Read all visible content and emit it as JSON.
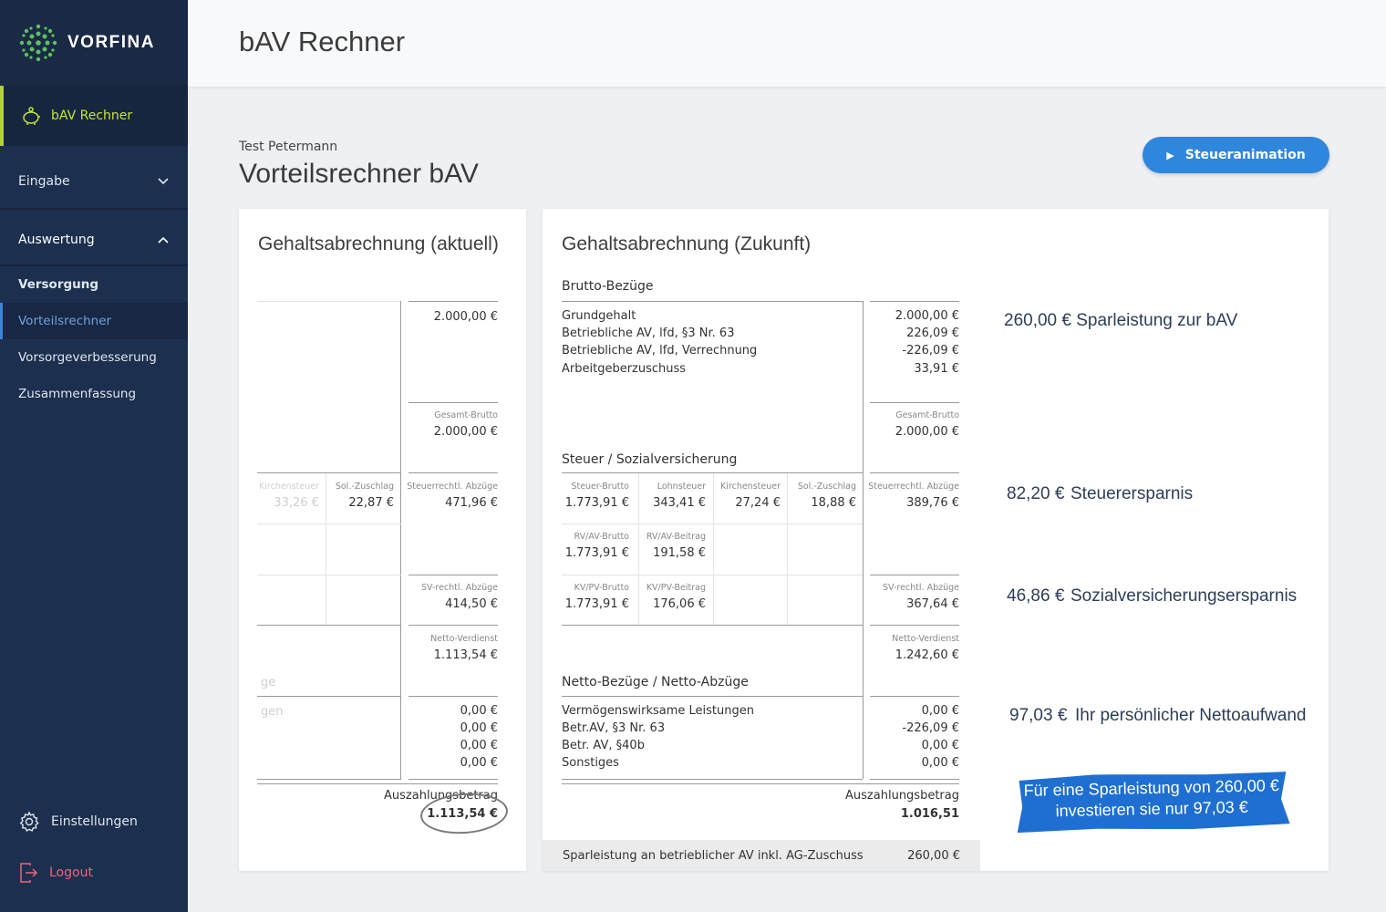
{
  "brand": {
    "name": "VORFINA"
  },
  "sidebar": {
    "active": "bAV Rechner",
    "eingabe": "Eingabe",
    "auswertung": "Auswertung",
    "sub_items": [
      "Versorgung",
      "Vorteilsrechner",
      "Vorsorgeverbesserung",
      "Zusammenfassung"
    ],
    "settings": "Einstellungen",
    "logout": "Logout"
  },
  "header": {
    "title": "bAV Rechner"
  },
  "page": {
    "customer": "Test Petermann",
    "title": "Vorteilsrechner bAV",
    "animation_button": "Steueranimation"
  },
  "current": {
    "title": "Gehaltsabrechnung (aktuell)",
    "brutto_value": "2.000,00 €",
    "gesamt_brutto_label": "Gesamt-Brutto",
    "gesamt_brutto_value": "2.000,00 €",
    "kirchensteuer_label": "Kirchensteuer",
    "kirchensteuer_value": "33,26 €",
    "soli_label": "Sol.-Zuschlag",
    "soli_value": "22,87 €",
    "steuer_abz_label": "Steuerrechtl. Abzüge",
    "steuer_abz_value": "471,96 €",
    "sv_abz_label": "SV-rechtl. Abzüge",
    "sv_abz_value": "414,50 €",
    "netto_label": "Netto-Verdienst",
    "netto_value": "1.113,54 €",
    "faded_ge": "ge",
    "faded_gen": "gen",
    "deductions": [
      "0,00 €",
      "0,00 €",
      "0,00 €",
      "0,00 €"
    ],
    "payout_label": "Auszahlungsbetrag",
    "payout_value": "1.113,54 €"
  },
  "future": {
    "title": "Gehaltsabrechnung (Zukunft)",
    "brutto_heading": "Brutto-Bezüge",
    "brutto_items": [
      "Grundgehalt",
      "Betriebliche AV, lfd, §3 Nr. 63",
      "Betriebliche AV, lfd, Verrechnung",
      "Arbeitgeberzuschuss"
    ],
    "brutto_values": [
      "2.000,00 €",
      "226,09 €",
      "-226,09 €",
      "33,91 €"
    ],
    "gesamt_brutto_label": "Gesamt-Brutto",
    "gesamt_brutto_value": "2.000,00 €",
    "steuer_heading": "Steuer / Sozialversicherung",
    "steuer_cells": [
      {
        "label": "Steuer-Brutto",
        "value": "1.773,91 €"
      },
      {
        "label": "Lohnsteuer",
        "value": "343,41 €"
      },
      {
        "label": "Kirchensteuer",
        "value": "27,24 €"
      },
      {
        "label": "Sol.-Zuschlag",
        "value": "18,88 €"
      }
    ],
    "steuer_abz_label": "Steuerrechtl. Abzüge",
    "steuer_abz_value": "389,76 €",
    "rv_cells": [
      {
        "label": "RV/AV-Brutto",
        "value": "1.773,91 €"
      },
      {
        "label": "RV/AV-Beitrag",
        "value": "191,58 €"
      }
    ],
    "kv_cells": [
      {
        "label": "KV/PV-Brutto",
        "value": "1.773,91 €"
      },
      {
        "label": "KV/PV-Beitrag",
        "value": "176,06 €"
      }
    ],
    "sv_abz_label": "SV-rechtl. Abzüge",
    "sv_abz_value": "367,64 €",
    "netto_label": "Netto-Verdienst",
    "netto_value": "1.242,60 €",
    "netto_heading": "Netto-Bezüge / Netto-Abzüge",
    "netto_items": [
      "Vermögenswirksame Leistungen",
      "Betr.AV, §3 Nr. 63",
      "Betr. AV, §40b",
      "Sonstiges"
    ],
    "netto_values": [
      "0,00 €",
      "-226,09 €",
      "0,00 €",
      "0,00 €"
    ],
    "payout_label": "Auszahlungsbetrag",
    "payout_value": "1.016,51",
    "footer_label": "Sparleistung an betrieblicher AV inkl. AG-Zuschuss",
    "footer_value": "260,00 €"
  },
  "summary": {
    "sparleistung": "260,00 € Sparleistung zur bAV",
    "steuer_value": "82,20 €",
    "steuer_label": "Steuerersparnis",
    "sv_value": "46,86 €",
    "sv_label": "Sozialversicherungsersparnis",
    "netto_value": "97,03 €",
    "netto_label": "Ihr persönlicher Nettoaufwand",
    "banner_line1": "Für eine Sparleistung von 260,00 €",
    "banner_line2": "investieren sie nur 97,03 €"
  }
}
